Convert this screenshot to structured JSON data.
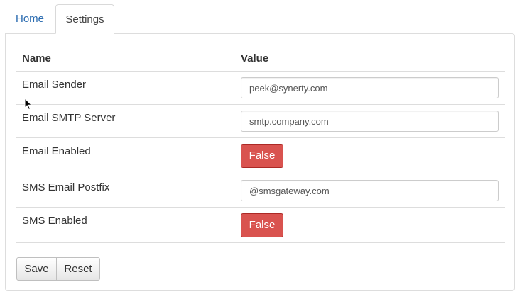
{
  "tabs": {
    "home_label": "Home",
    "settings_label": "Settings"
  },
  "table": {
    "header_name": "Name",
    "header_value": "Value",
    "rows": [
      {
        "name": "Email Sender",
        "value": "peek@synerty.com"
      },
      {
        "name": "Email SMTP Server",
        "value": "smtp.company.com"
      },
      {
        "name": "Email Enabled",
        "value": "False"
      },
      {
        "name": "SMS Email Postfix",
        "value": "@smsgateway.com"
      },
      {
        "name": "SMS Enabled",
        "value": "False"
      }
    ]
  },
  "actions": {
    "save_label": "Save",
    "reset_label": "Reset"
  },
  "colors": {
    "link": "#2a6bb0",
    "danger": "#d9534f"
  }
}
